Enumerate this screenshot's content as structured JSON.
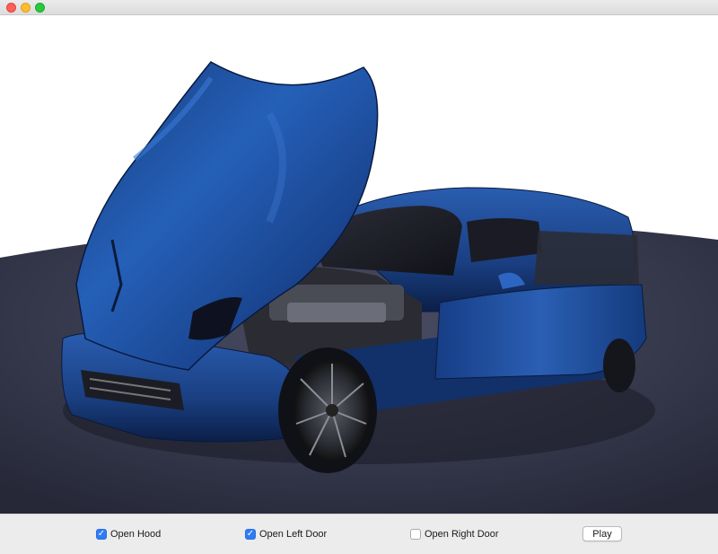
{
  "controls": {
    "open_hood": {
      "label": "Open Hood",
      "checked": true
    },
    "open_left_door": {
      "label": "Open Left Door",
      "checked": true
    },
    "open_right_door": {
      "label": "Open Right Door",
      "checked": false
    },
    "play_label": "Play"
  },
  "colors": {
    "car_paint": "#1f4f9a",
    "floor": "#3a3d4f",
    "checkbox_accent": "#2f7cf6",
    "traffic_close": "#fe5f57",
    "traffic_minimize": "#febc2e",
    "traffic_maximize": "#28c840"
  },
  "icons": {
    "checked": "checkmark-icon"
  }
}
